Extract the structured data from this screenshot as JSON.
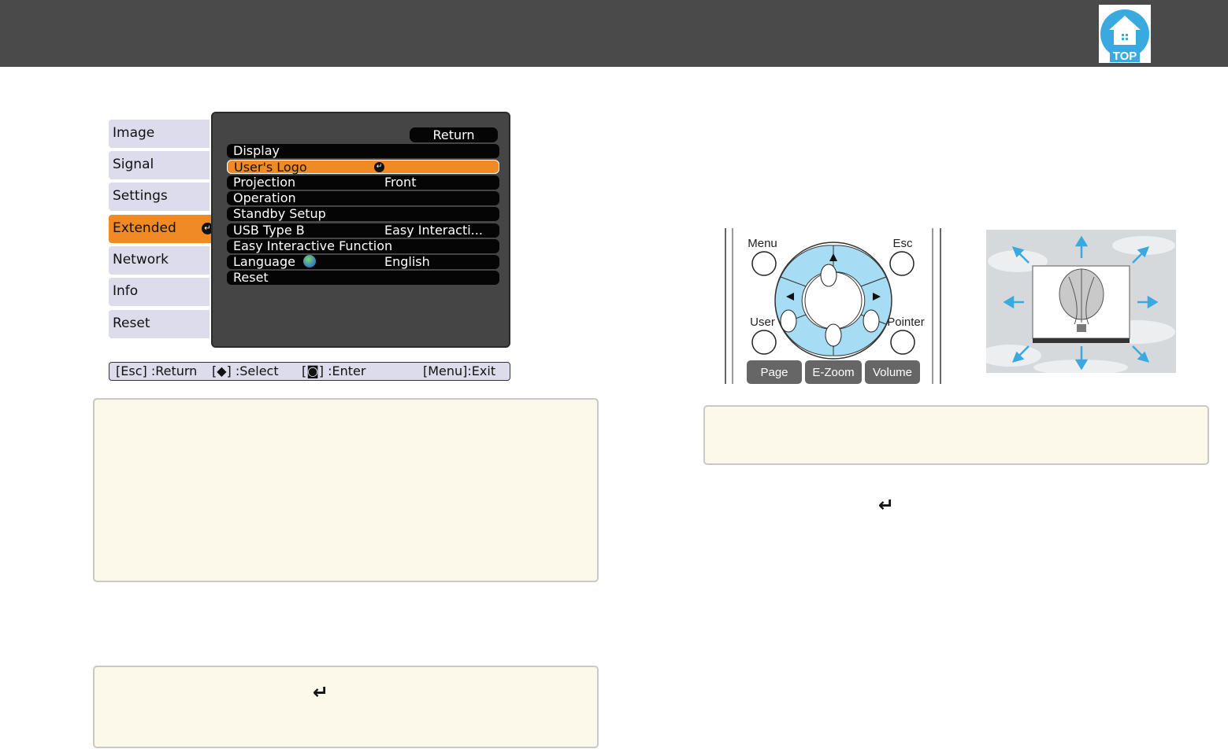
{
  "header": {
    "top_icon_label": "TOP"
  },
  "osd": {
    "tabs": [
      {
        "label": "Image",
        "active": false
      },
      {
        "label": "Signal",
        "active": false
      },
      {
        "label": "Settings",
        "active": false
      },
      {
        "label": "Extended",
        "active": true
      },
      {
        "label": "Network",
        "active": false
      },
      {
        "label": "Info",
        "active": false
      },
      {
        "label": "Reset",
        "active": false
      }
    ],
    "return_label": "Return",
    "rows": [
      {
        "label": "Display",
        "value": ""
      },
      {
        "label": "User's Logo",
        "value": "",
        "selected": true
      },
      {
        "label": "Projection",
        "value": "Front"
      },
      {
        "label": "Operation",
        "value": ""
      },
      {
        "label": "Standby Setup",
        "value": ""
      },
      {
        "label": "USB Type B",
        "value": "Easy Interacti..."
      },
      {
        "label": "Easy Interactive Function",
        "value": ""
      },
      {
        "label": "Language",
        "value": "English"
      },
      {
        "label": "Reset",
        "value": ""
      }
    ],
    "footer": {
      "esc": "[Esc] :Return",
      "select": "[◆] :Select",
      "enter": "[◙] :Enter",
      "menu": "[Menu]:Exit"
    }
  },
  "remote": {
    "labels": {
      "menu": "Menu",
      "esc": "Esc",
      "user": "User",
      "pointer": "Pointer",
      "page": "Page",
      "ezoom": "E-Zoom",
      "volume": "Volume"
    }
  },
  "colors": {
    "header_bg": "#4a4a4a",
    "accent": "#f08a25",
    "note_bg": "#fdf9ea",
    "tab_bg": "#dcdcec"
  },
  "icons": {
    "top_icon": "home-top-icon",
    "enter_icon": "enter-return-icon"
  }
}
